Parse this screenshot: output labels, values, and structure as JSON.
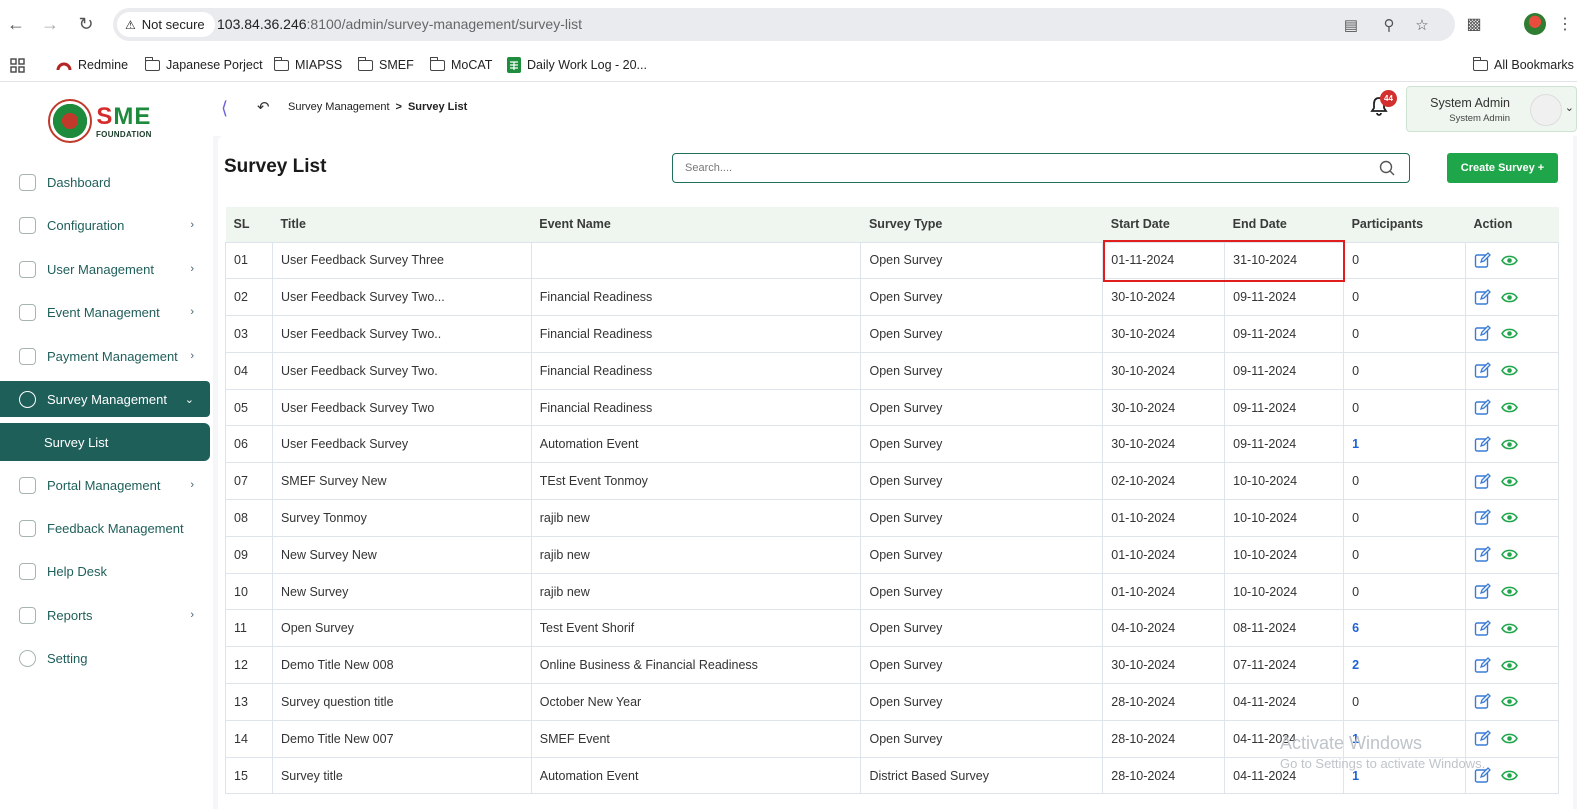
{
  "browser": {
    "security_label": "Not secure",
    "url_host": "103.84.36.246",
    "url_rest": ":8100/admin/survey-management/survey-list"
  },
  "bookmarks": {
    "items": [
      "Redmine",
      "Japanese Porject",
      "MIAPSS",
      "SMEF",
      "MoCAT",
      "Daily Work Log - 20..."
    ],
    "all_bookmarks": "All Bookmarks"
  },
  "logo": {
    "sme_s": "S",
    "sme_m": "M",
    "sme_e": "E",
    "foundation": "FOUNDATION"
  },
  "sidebar": {
    "items": [
      {
        "label": "Dashboard",
        "has_chevron": false
      },
      {
        "label": "Configuration",
        "has_chevron": true
      },
      {
        "label": "User Management",
        "has_chevron": true
      },
      {
        "label": "Event Management",
        "has_chevron": true
      },
      {
        "label": "Payment Management",
        "has_chevron": true
      },
      {
        "label": "Survey Management",
        "has_chevron": true,
        "active": true
      },
      {
        "label": "Survey List",
        "sub": true
      },
      {
        "label": "Portal Management",
        "has_chevron": true
      },
      {
        "label": "Feedback Management",
        "has_chevron": false
      },
      {
        "label": "Help Desk",
        "has_chevron": false
      },
      {
        "label": "Reports",
        "has_chevron": true
      },
      {
        "label": "Setting",
        "has_chevron": false
      }
    ]
  },
  "topbar": {
    "breadcrumb_parent": "Survey Management",
    "breadcrumb_sep": ">",
    "breadcrumb_current": "Survey List",
    "notification_count": "44",
    "user_name": "System Admin",
    "user_role": "System Admin"
  },
  "page": {
    "title": "Survey List",
    "search_placeholder": "Search....",
    "create_button": "Create Survey +"
  },
  "table": {
    "headers": [
      "SL",
      "Title",
      "Event Name",
      "Survey Type",
      "Start Date",
      "End Date",
      "Participants",
      "Action"
    ],
    "rows": [
      [
        "01",
        "User Feedback Survey Three",
        "",
        "Open Survey",
        "01-11-2024",
        "31-10-2024",
        "0"
      ],
      [
        "02",
        "User Feedback Survey Two...",
        "Financial Readiness",
        "Open Survey",
        "30-10-2024",
        "09-11-2024",
        "0"
      ],
      [
        "03",
        "User Feedback Survey Two..",
        "Financial Readiness",
        "Open Survey",
        "30-10-2024",
        "09-11-2024",
        "0"
      ],
      [
        "04",
        "User Feedback Survey Two.",
        "Financial Readiness",
        "Open Survey",
        "30-10-2024",
        "09-11-2024",
        "0"
      ],
      [
        "05",
        "User Feedback Survey Two",
        "Financial Readiness",
        "Open Survey",
        "30-10-2024",
        "09-11-2024",
        "0"
      ],
      [
        "06",
        "User Feedback Survey",
        "Automation Event",
        "Open Survey",
        "30-10-2024",
        "09-11-2024",
        "1"
      ],
      [
        "07",
        "SMEF Survey New",
        "TEst Event Tonmoy",
        "Open Survey",
        "02-10-2024",
        "10-10-2024",
        "0"
      ],
      [
        "08",
        "Survey Tonmoy",
        "rajib new",
        "Open Survey",
        "01-10-2024",
        "10-10-2024",
        "0"
      ],
      [
        "09",
        "New Survey New",
        "rajib new",
        "Open Survey",
        "01-10-2024",
        "10-10-2024",
        "0"
      ],
      [
        "10",
        "New Survey",
        "rajib new",
        "Open Survey",
        "01-10-2024",
        "10-10-2024",
        "0"
      ],
      [
        "11",
        "Open Survey",
        "Test Event Shorif",
        "Open Survey",
        "04-10-2024",
        "08-11-2024",
        "6"
      ],
      [
        "12",
        "Demo Title New 008",
        "Online Business & Financial Readiness",
        "Open Survey",
        "30-10-2024",
        "07-11-2024",
        "2"
      ],
      [
        "13",
        "Survey question title",
        "October New Year",
        "Open Survey",
        "28-10-2024",
        "04-11-2024",
        "0"
      ],
      [
        "14",
        "Demo Title New 007",
        "SMEF Event",
        "Open Survey",
        "28-10-2024",
        "04-11-2024",
        "1"
      ],
      [
        "15",
        "Survey title",
        "Automation Event",
        "District Based Survey",
        "28-10-2024",
        "04-11-2024",
        "1"
      ]
    ]
  },
  "watermark": {
    "line1": "Activate Windows",
    "line2": "Go to Settings to activate Windows."
  },
  "colors": {
    "brand_green": "#1f5f5a",
    "button_green": "#1fa64a",
    "link_blue": "#1f62d6",
    "highlight_red": "#e01e1e"
  }
}
